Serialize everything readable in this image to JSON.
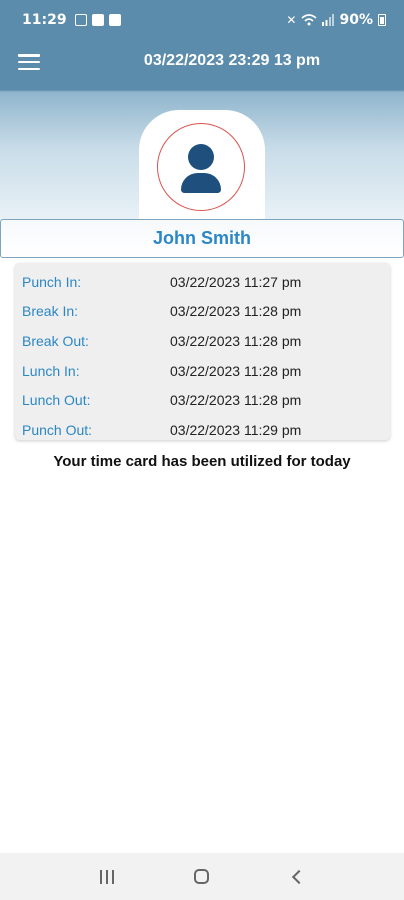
{
  "status_bar": {
    "time": "11:29",
    "battery": "90%",
    "icons": [
      "sd-card-icon",
      "checkbox-icon",
      "image-icon",
      "mute-icon",
      "wifi-icon",
      "signal-icon",
      "battery-icon"
    ]
  },
  "app_bar": {
    "title": "03/22/2023 23:29 13 pm",
    "menu_icon": "hamburger-menu-icon"
  },
  "profile": {
    "name": "John Smith",
    "avatar_icon": "user-avatar-icon"
  },
  "punches": [
    {
      "label": "Punch In:",
      "value": "03/22/2023 11:27 pm"
    },
    {
      "label": "Break In:",
      "value": "03/22/2023 11:28 pm"
    },
    {
      "label": "Break Out:",
      "value": "03/22/2023 11:28 pm"
    },
    {
      "label": "Lunch In:",
      "value": "03/22/2023 11:28 pm"
    },
    {
      "label": "Lunch Out:",
      "value": "03/22/2023 11:28 pm"
    },
    {
      "label": "Punch Out:",
      "value": "03/22/2023 11:29 pm"
    }
  ],
  "message": "Your time card has been utilized for today",
  "colors": {
    "header": "#5b8cac",
    "accent_blue": "#2b87c6",
    "avatar": "#1e4f7d",
    "avatar_ring": "#d9534f"
  },
  "nav_bar": {
    "icons": [
      "recents-icon",
      "home-icon",
      "back-icon"
    ]
  }
}
